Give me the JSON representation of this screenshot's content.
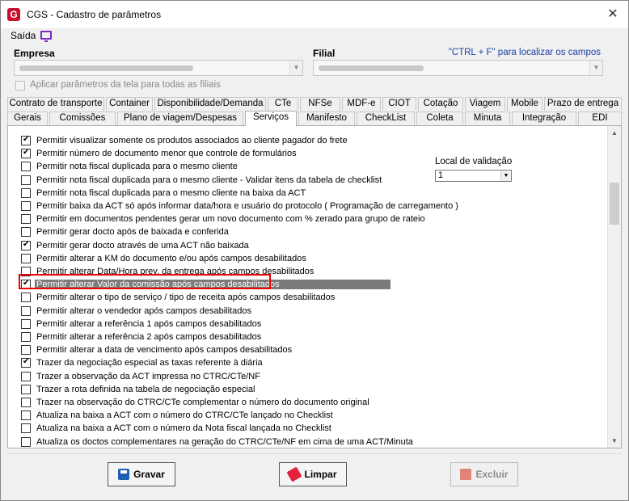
{
  "window": {
    "title": "CGS - Cadastro de parâmetros",
    "app_icon": "G",
    "close": "✕"
  },
  "menu": {
    "saida": "Saída"
  },
  "empresa": {
    "label": "Empresa"
  },
  "filial": {
    "label": "Filial"
  },
  "hint": "\"CTRL + F\" para localizar os campos",
  "apply_all": "Aplicar parâmetros da tela para todas as filiais",
  "tabs_row1": [
    "Contrato de transporte",
    "Container",
    "Disponibilidade/Demanda",
    "CTe",
    "NFSe",
    "MDF-e",
    "CIOT",
    "Cotação",
    "Viagem",
    "Mobile",
    "Prazo de entrega"
  ],
  "tabs_row2": [
    "Gerais",
    "Comissões",
    "Plano de viagem/Despesas",
    "Serviços",
    "Manifesto",
    "CheckList",
    "Coleta",
    "Minuta",
    "Integração",
    "EDI"
  ],
  "active_tab": "Serviços",
  "options": [
    {
      "label": "Permitir visualizar somente os produtos associados ao cliente pagador do frete",
      "checked": true
    },
    {
      "label": "Permitir número de documento menor que controle de formulários",
      "checked": true
    },
    {
      "label": "Permitir nota fiscal duplicada para o mesmo cliente",
      "checked": false
    },
    {
      "label": "Permitir nota fiscal duplicada para o mesmo cliente - Validar itens da tabela de checklist",
      "checked": false
    },
    {
      "label": "Permitir nota fiscal duplicada para o mesmo cliente na baixa da ACT",
      "checked": false
    },
    {
      "label": "Permitir baixa da ACT só após informar data/hora e usuário do protocolo ( Programação de carregamento )",
      "checked": false
    },
    {
      "label": "Permitir em documentos pendentes gerar um novo documento com % zerado para grupo de rateio",
      "checked": false
    },
    {
      "label": "Permitir gerar docto após de baixada e conferida",
      "checked": false
    },
    {
      "label": "Permitir gerar docto através de uma ACT não baixada",
      "checked": true
    },
    {
      "label": "Permitir alterar a KM do documento e/ou após campos desabilitados",
      "checked": false
    },
    {
      "label": "Permitir alterar Data/Hora prev. da entrega após campos desabilitados",
      "checked": false
    },
    {
      "label": "Permitir alterar Valor da comissão após campos desabilitados",
      "checked": true
    },
    {
      "label": "Permitir alterar o tipo de serviço / tipo de receita após campos desabilitados",
      "checked": false
    },
    {
      "label": "Permitir alterar o vendedor após campos desabilitados",
      "checked": false
    },
    {
      "label": "Permitir alterar a referência 1 após campos desabilitados",
      "checked": false
    },
    {
      "label": "Permitir alterar a referência 2 após campos desabilitados",
      "checked": false
    },
    {
      "label": "Permitir alterar a data de vencimento após campos desabilitados",
      "checked": false
    },
    {
      "label": "Trazer da negociação especial as taxas referente à diária",
      "checked": true
    },
    {
      "label": "Trazer a observação da ACT impressa no CTRC/CTe/NF",
      "checked": false
    },
    {
      "label": "Trazer a rota definida na tabela de negociação especial",
      "checked": false
    },
    {
      "label": "Trazer na observação do CTRC/CTe complementar o número do documento original",
      "checked": false
    },
    {
      "label": "Atualiza na baixa a ACT com o número do CTRC/CTe lançado no Checklist",
      "checked": false
    },
    {
      "label": "Atualiza na baixa a ACT com o número da Nota fiscal lançada no Checklist",
      "checked": false
    },
    {
      "label": "Atualiza os doctos complementares na geração do CTRC/CTe/NF em cima de uma ACT/Minuta",
      "checked": false
    }
  ],
  "local_validacao": {
    "label": "Local de validação",
    "value": "1"
  },
  "buttons": {
    "gravar": "Gravar",
    "limpar": "Limpar",
    "excluir": "Excluir"
  }
}
